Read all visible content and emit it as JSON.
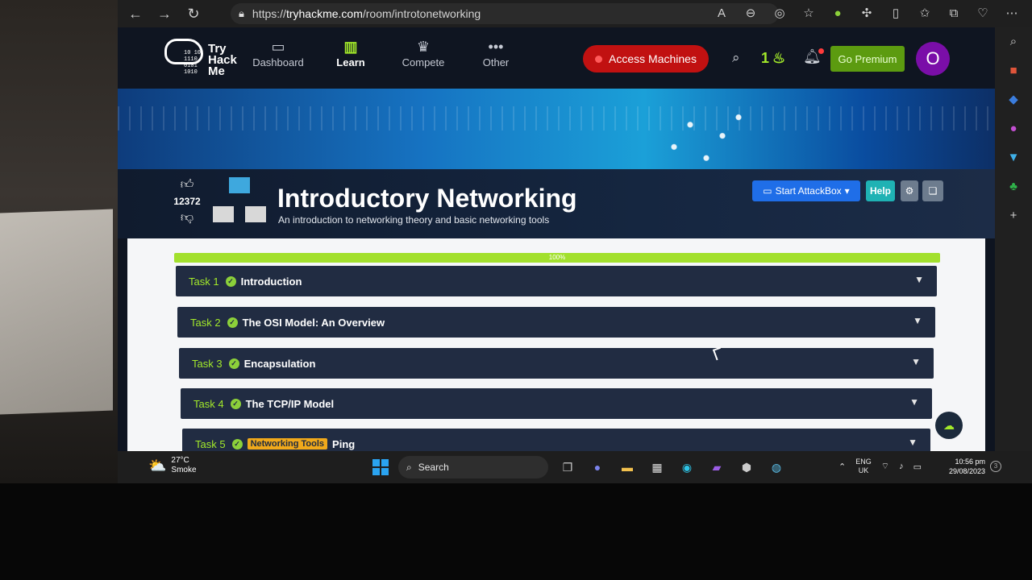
{
  "browser": {
    "url_prefix": "https://",
    "url_domain": "tryhackme.com",
    "url_path": "/room/introtonetworking",
    "icons": [
      "read-aloud-icon",
      "zoom-icon",
      "tracking-icon",
      "favorite-icon",
      "extension-green-icon",
      "extensions-icon",
      "split-screen-icon",
      "favorites-icon",
      "collections-icon",
      "health-icon",
      "more-icon"
    ]
  },
  "nav": {
    "logo_text": "Try Hack Me",
    "logo_bits": "10 10 1110 0101 1010",
    "links": [
      {
        "label": "Dashboard",
        "icon": "dashboard-icon"
      },
      {
        "label": "Learn",
        "icon": "book-icon"
      },
      {
        "label": "Compete",
        "icon": "trophy-icon"
      },
      {
        "label": "Other",
        "icon": "dots-icon"
      }
    ],
    "access_label": "Access Machines",
    "streak_count": "1",
    "premium_label": "Go Premium",
    "avatar_letter": "O"
  },
  "room": {
    "votes": "12372",
    "title": "Introductory Networking",
    "subtitle": "An introduction to networking theory and basic networking tools",
    "attackbox_label": "Start AttackBox",
    "help_label": "Help",
    "progress_percent": 100,
    "progress_label": "100%"
  },
  "tasks": [
    {
      "num": "Task 1",
      "title": "Introduction",
      "tag": ""
    },
    {
      "num": "Task 2",
      "title": "The OSI Model: An Overview",
      "tag": ""
    },
    {
      "num": "Task 3",
      "title": "Encapsulation",
      "tag": ""
    },
    {
      "num": "Task 4",
      "title": "The TCP/IP Model",
      "tag": ""
    },
    {
      "num": "Task 5",
      "title": "Ping",
      "tag": "Networking Tools"
    }
  ],
  "taskbar": {
    "temp": "27°C",
    "weather": "Smoke",
    "search_label": "Search",
    "lang_1": "ENG",
    "lang_2": "UK",
    "time": "10:56 pm",
    "date": "29/08/2023",
    "notif_count": "3"
  }
}
